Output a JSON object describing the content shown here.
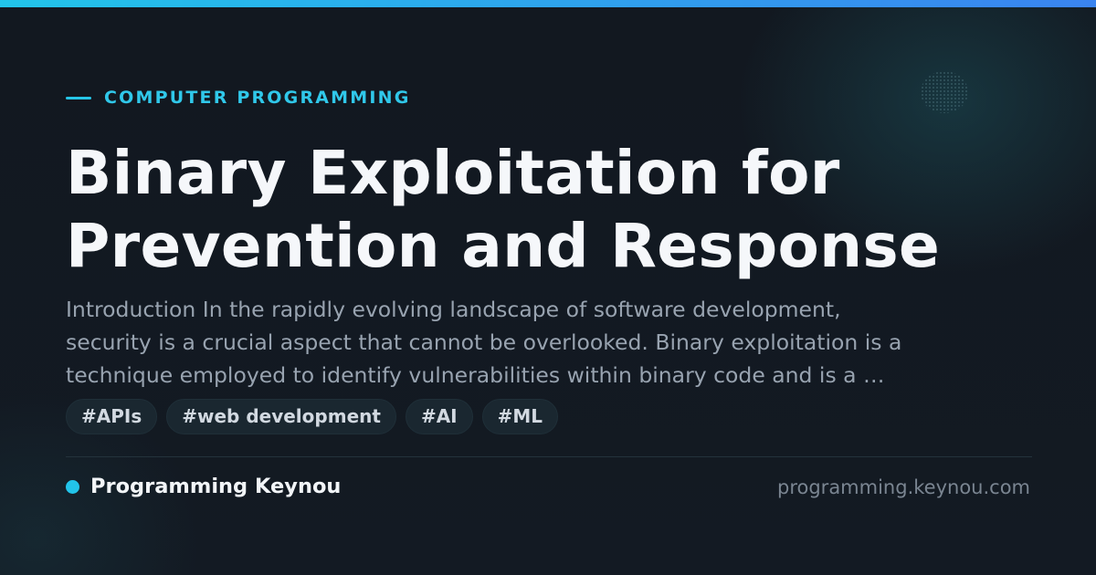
{
  "category": "COMPUTER PROGRAMMING",
  "title_lines": [
    "Binary Exploitation for",
    "Prevention and Response"
  ],
  "excerpt_lines": [
    "Introduction In the rapidly evolving landscape of software development,",
    "security is a crucial aspect that cannot be overlooked. Binary exploitation is a",
    "technique employed to identify vulnerabilities within binary code and is a …"
  ],
  "tags": [
    "#APIs",
    "#web development",
    "#AI",
    "#ML"
  ],
  "brand": "Programming Keynou",
  "domain": "programming.keynou.com",
  "colors": {
    "accent": "#22c4ea",
    "accent_end": "#3a84f0",
    "background": "#111820",
    "title": "#f5f7fa",
    "excerpt": "#98a3b0",
    "domain": "#7a8591"
  }
}
